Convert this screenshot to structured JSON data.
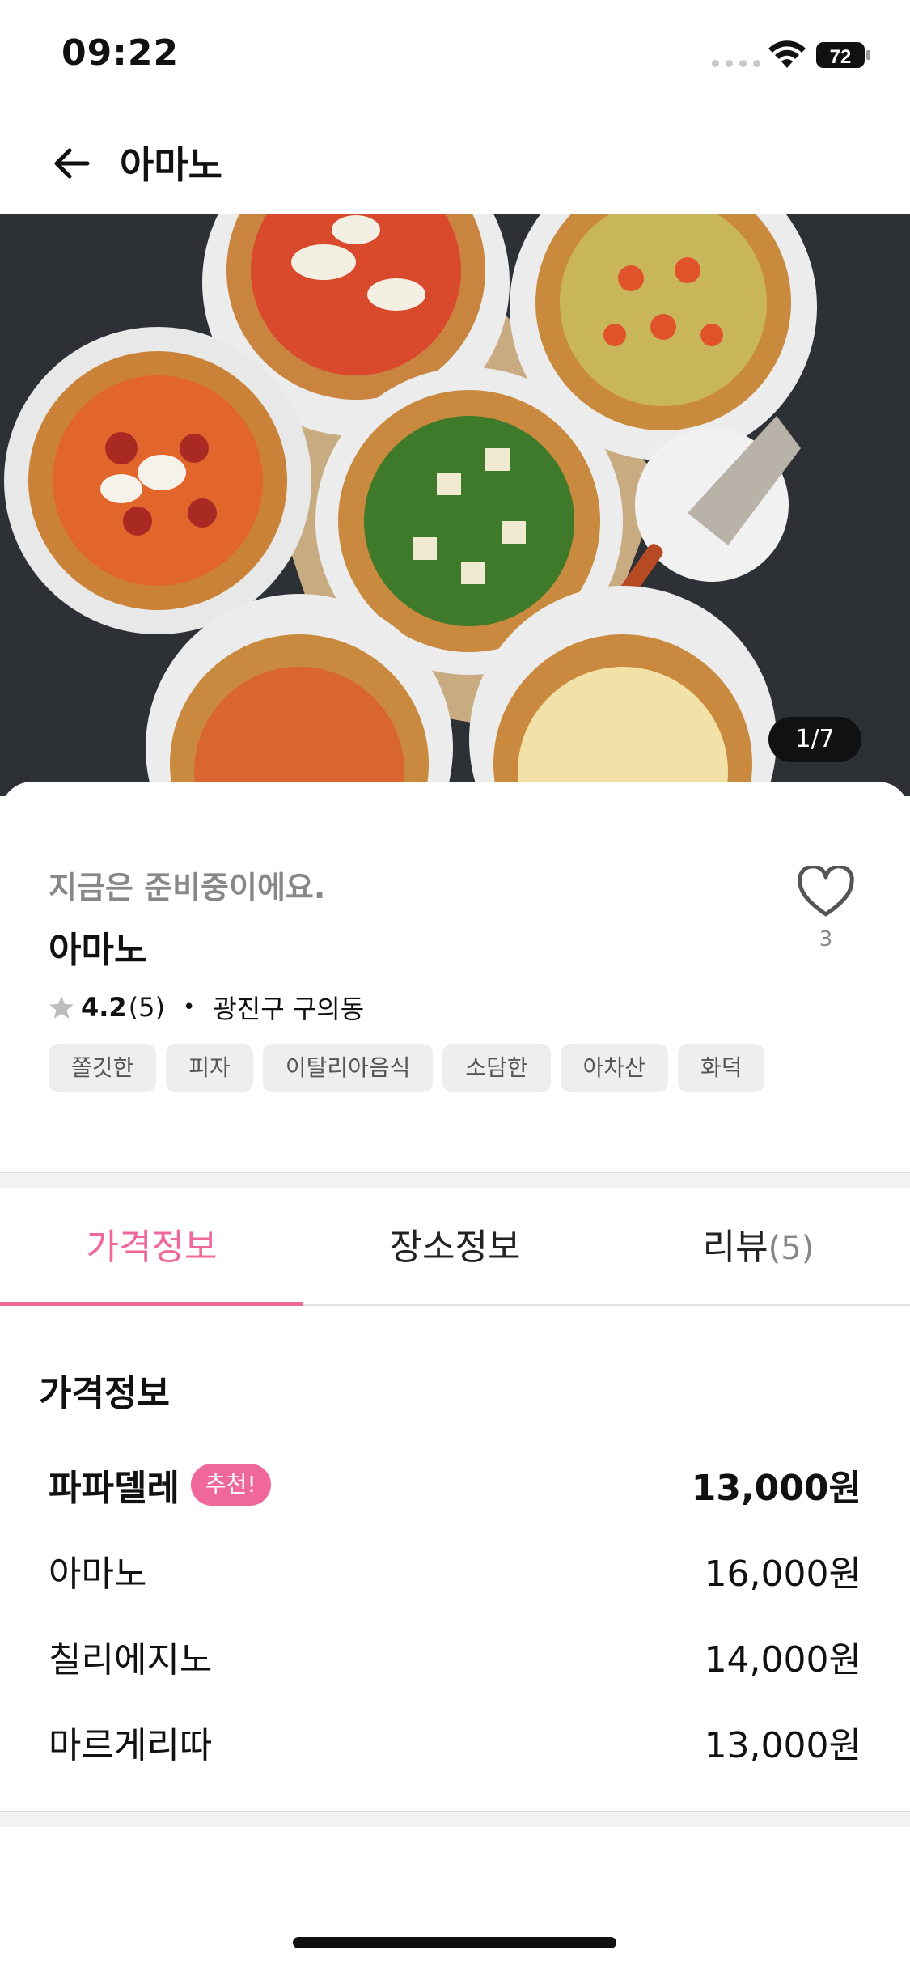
{
  "status_bar": {
    "time": "09:22",
    "battery": "72"
  },
  "nav": {
    "title": "아마노"
  },
  "hero": {
    "counter": "1/7"
  },
  "store": {
    "status_message": "지금은 준비중이에요.",
    "name": "아마노",
    "like_count": "3",
    "rating": "4.2",
    "review_count": "(5)",
    "location": "광진구 구의동",
    "tags": [
      "쫄깃한",
      "피자",
      "이탈리아음식",
      "소담한",
      "아차산",
      "화덕"
    ]
  },
  "tabs": [
    {
      "label": "가격정보",
      "count": ""
    },
    {
      "label": "장소정보",
      "count": ""
    },
    {
      "label": "리뷰",
      "count": "(5)"
    }
  ],
  "price_section": {
    "heading": "가격정보",
    "badge": "추천!",
    "items": [
      {
        "name": "파파델레",
        "price": "13,000원"
      },
      {
        "name": "아마노",
        "price": "16,000원"
      },
      {
        "name": "칠리에지노",
        "price": "14,000원"
      },
      {
        "name": "마르게리따",
        "price": "13,000원"
      }
    ]
  },
  "colors": {
    "accent": "#f0679c",
    "muted_text": "#888888",
    "tag_bg": "#eeeeee"
  }
}
